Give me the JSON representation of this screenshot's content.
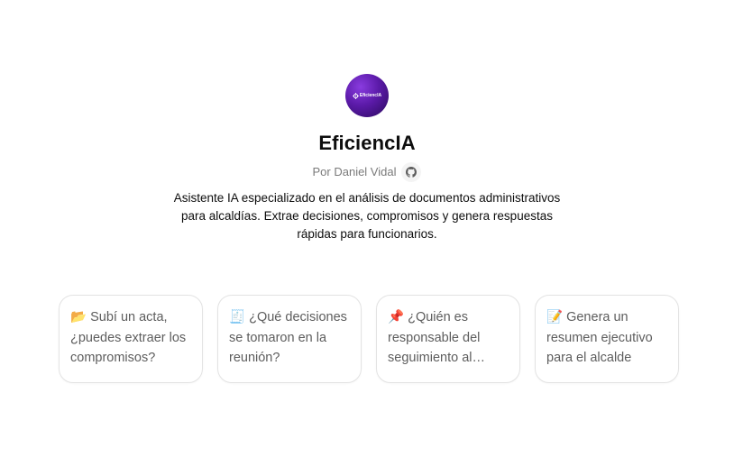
{
  "gpt": {
    "avatar_text": "EficiencIA",
    "name": "EficiencIA",
    "author": "Por Daniel Vidal",
    "github_icon": "github-icon",
    "description": "Asistente IA especializado en el análisis de documentos administrativos para alcaldías. Extrae decisiones, compromisos y genera respuestas rápidas para funcionarios.",
    "brand_color": "#5b1aa8"
  },
  "starters": [
    {
      "emoji": "📂",
      "text": "Subí un acta, ¿puedes extraer los compromisos?"
    },
    {
      "emoji": "🧾",
      "text": "¿Qué decisiones se tomaron en la reunión?"
    },
    {
      "emoji": "📌",
      "text": "¿Quién es responsable del seguimiento al compromiso?"
    },
    {
      "emoji": "📝",
      "text": "Genera un resumen ejecutivo para el alcalde"
    }
  ]
}
